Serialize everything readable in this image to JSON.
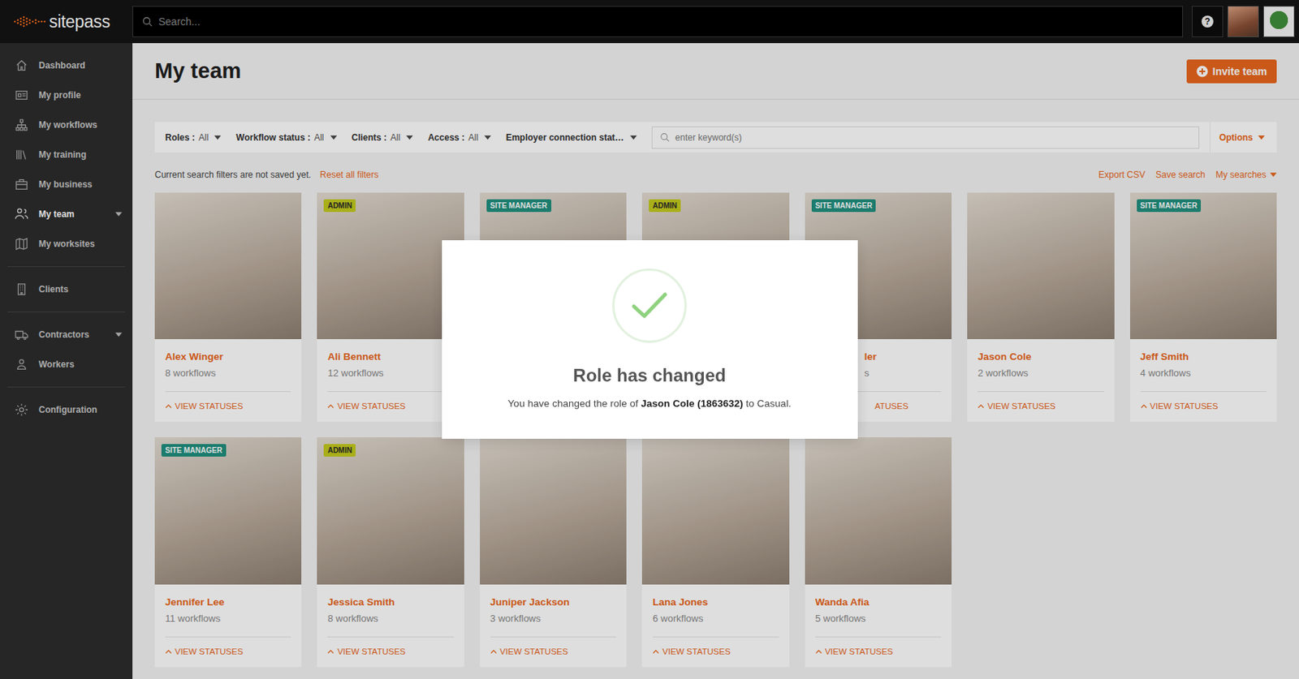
{
  "topbar": {
    "logo": "sitepass",
    "search_placeholder": "Search...",
    "help": "?"
  },
  "sidebar": {
    "items": [
      {
        "label": "Dashboard",
        "selected": false,
        "expandable": false,
        "section": 1
      },
      {
        "label": "My profile",
        "selected": false,
        "expandable": false,
        "section": 1
      },
      {
        "label": "My workflows",
        "selected": false,
        "expandable": false,
        "section": 1
      },
      {
        "label": "My training",
        "selected": false,
        "expandable": false,
        "section": 1
      },
      {
        "label": "My business",
        "selected": false,
        "expandable": false,
        "section": 1
      },
      {
        "label": "My team",
        "selected": true,
        "expandable": true,
        "section": 1
      },
      {
        "label": "My worksites",
        "selected": false,
        "expandable": false,
        "section": 1
      },
      {
        "label": "Clients",
        "selected": false,
        "expandable": false,
        "section": 2
      },
      {
        "label": "Contractors",
        "selected": false,
        "expandable": true,
        "section": 3
      },
      {
        "label": "Workers",
        "selected": false,
        "expandable": false,
        "section": 3
      },
      {
        "label": "Configuration",
        "selected": false,
        "expandable": false,
        "section": 4
      }
    ]
  },
  "page": {
    "title": "My team",
    "invite_button": "Invite team"
  },
  "filters": {
    "items": [
      {
        "label": "Roles :",
        "value": "All"
      },
      {
        "label": "Workflow status :",
        "value": "All"
      },
      {
        "label": "Clients :",
        "value": "All"
      },
      {
        "label": "Access :",
        "value": "All"
      },
      {
        "label": "Employer connection stat…",
        "value": ""
      }
    ],
    "keyword_placeholder": "enter keyword(s)",
    "options": "Options"
  },
  "search_bar": {
    "notice": "Current search filters are not saved yet.",
    "reset": "Reset all filters",
    "actions": [
      {
        "label": "Export CSV",
        "dropdown": false
      },
      {
        "label": "Save search",
        "dropdown": false
      },
      {
        "label": "My searches",
        "dropdown": true
      }
    ]
  },
  "team": {
    "cards": [
      {
        "name": "Alex Winger",
        "workflows": "8 workflows",
        "statuses": "VIEW STATUSES",
        "clipped": false
      },
      {
        "name": "Ali Bennett",
        "workflows": "12 workflows",
        "statuses": "VIEW STATUSES",
        "clipped": false,
        "badge": {
          "text": "ADMIN",
          "color": "#c3c91d"
        }
      },
      {
        "name": "",
        "workflows": "",
        "statuses": "",
        "clipped": false,
        "badge": {
          "text": "SITE MANAGER",
          "color": "#1f8f7e"
        }
      },
      {
        "name": "",
        "workflows": "",
        "statuses": "",
        "clipped": false,
        "badge": {
          "text": "ADMIN",
          "color": "#c3c91d"
        }
      },
      {
        "name": "ler",
        "workflows": "s",
        "statuses": "ATUSES",
        "clipped": true,
        "badge": {
          "text": "SITE MANAGER",
          "color": "#1f8f7e"
        }
      },
      {
        "name": "Jason Cole",
        "workflows": "2 workflows",
        "statuses": "VIEW STATUSES",
        "clipped": false
      },
      {
        "name": "Jeff Smith",
        "workflows": "4 workflows",
        "statuses": "VIEW STATUSES",
        "clipped": false,
        "badge": {
          "text": "SITE MANAGER",
          "color": "#1f8f7e"
        }
      },
      {
        "name": "Jennifer Lee",
        "workflows": "11 workflows",
        "statuses": "VIEW STATUSES",
        "clipped": false,
        "badge": {
          "text": "SITE MANAGER",
          "color": "#1f8f7e"
        }
      },
      {
        "name": "Jessica Smith",
        "workflows": "8 workflows",
        "statuses": "VIEW STATUSES",
        "clipped": false,
        "badge": {
          "text": "ADMIN",
          "color": "#c3c91d"
        }
      },
      {
        "name": "Juniper Jackson",
        "workflows": "3 workflows",
        "statuses": "VIEW STATUSES",
        "clipped": false
      },
      {
        "name": "Lana Jones",
        "workflows": "6 workflows",
        "statuses": "VIEW STATUSES",
        "clipped": false
      },
      {
        "name": "Wanda Afia",
        "workflows": "5 workflows",
        "statuses": "VIEW STATUSES",
        "clipped": false
      }
    ]
  },
  "modal": {
    "title": "Role has changed",
    "message_start": "You have changed the role of ",
    "message_name": "Jason Cole (1863632)",
    "message_end": " to Casual."
  }
}
